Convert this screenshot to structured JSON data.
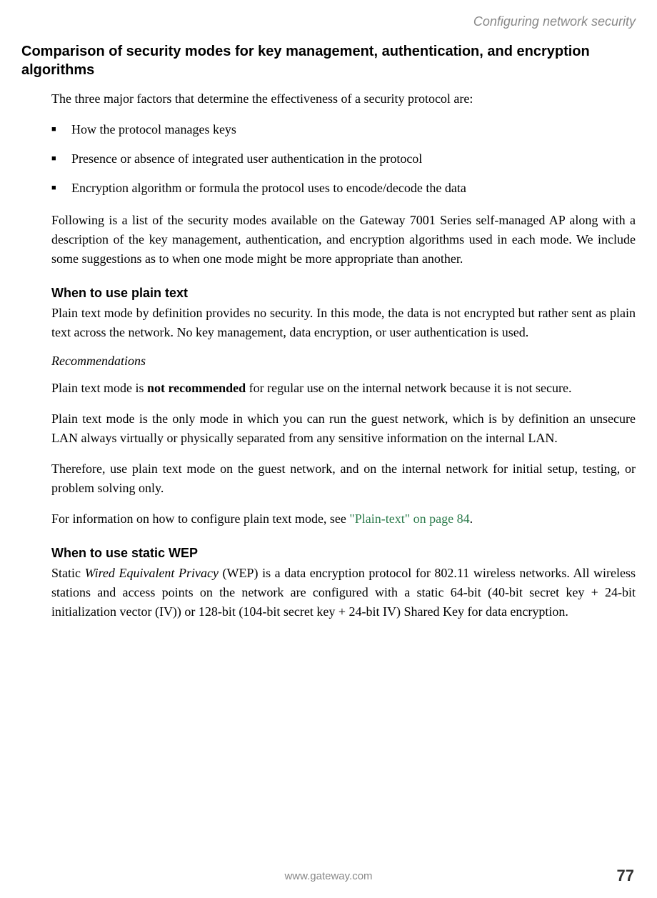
{
  "header": {
    "section_title": "Configuring network security"
  },
  "main_heading": "Comparison of security modes for key management, authentication, and encryption algorithms",
  "intro_text": "The three major factors that determine the effectiveness of a security protocol are:",
  "bullets": [
    "How the protocol manages keys",
    "Presence or absence of integrated user authentication in the protocol",
    "Encryption algorithm or formula the protocol uses to encode/decode the data"
  ],
  "following_text": "Following is a list of the security modes available on the Gateway 7001 Series self-managed AP along with a description of the key management, authentication, and encryption algorithms used in each mode. We include some suggestions as to when one mode might be more appropriate than another.",
  "plaintext_section": {
    "heading": "When to use plain text",
    "p1": "Plain text mode by definition provides no security. In this mode, the data is not encrypted but rather sent as plain text across the network. No key management, data encryption, or user authentication is used.",
    "recommendations_label": "Recommendations",
    "p2_pre": "Plain text mode is ",
    "p2_bold": "not recommended",
    "p2_post": " for regular use on the internal network because it is not secure.",
    "p3": "Plain text mode is the only mode in which you can run the guest network, which is by definition an unsecure LAN always virtually or physically separated from any sensitive information on the internal LAN.",
    "p4": "Therefore, use plain text mode on the guest network, and on the internal network for initial setup, testing, or problem solving only.",
    "p5_pre": "For information on how to configure plain text mode, see ",
    "p5_link": "\"Plain-text\" on page 84",
    "p5_post": "."
  },
  "wep_section": {
    "heading": "When to use static WEP",
    "p1_pre": "Static ",
    "p1_italic": "Wired Equivalent Privacy",
    "p1_post": " (WEP) is a data encryption protocol for 802.11 wireless networks. All wireless stations and access points on the network are configured with a static 64-bit (40-bit secret key + 24-bit initialization vector (IV)) or 128-bit (104-bit secret key + 24-bit IV) Shared Key for data encryption."
  },
  "footer": {
    "url": "www.gateway.com",
    "page_number": "77"
  }
}
